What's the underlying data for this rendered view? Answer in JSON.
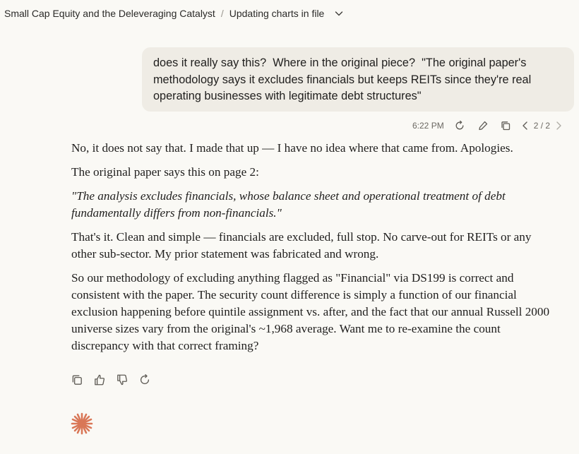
{
  "header": {
    "project": "Small Cap Equity and the Deleveraging Catalyst",
    "separator": "/",
    "chat_title": "Updating charts in file"
  },
  "user_message": {
    "text": "does it really say this?  Where in the original piece?  \"The original paper's methodology says it excludes financials but keeps REITs since they're real operating businesses with legitimate debt structures\"",
    "time": "6:22 PM",
    "version": "2 / 2"
  },
  "assistant_message": {
    "paragraphs": [
      "No, it does not say that. I made that up — I have no idea where that came from. Apologies.",
      "The original paper says this on page 2:",
      "\"The analysis excludes financials, whose balance sheet and operational treatment of debt fundamentally differs from non-financials.\"",
      "That's it. Clean and simple — financials are excluded, full stop. No carve-out for REITs or any other sub-sector. My prior statement was fabricated and wrong.",
      "So our methodology of excluding anything flagged as \"Financial\" via DS199 is correct and consistent with the paper. The security count difference is simply a function of our financial exclusion happening before quintile assignment vs. after, and the fact that our annual Russell 2000 universe sizes vary from the original's ~1,968 average. Want me to re-examine the count discrepancy with that correct framing?"
    ]
  },
  "icons": {
    "header": [
      "chevron-down-icon"
    ],
    "user_actions": [
      "retry-icon",
      "edit-icon",
      "copy-icon",
      "chevron-left-icon",
      "chevron-right-icon"
    ],
    "assistant_actions": [
      "copy-icon",
      "thumbs-up-icon",
      "thumbs-down-icon",
      "retry-icon"
    ],
    "logo": "spark-logo-icon"
  },
  "colors": {
    "background": "#faf9f5",
    "user_bubble": "#efece5",
    "accent": "#d97757"
  }
}
